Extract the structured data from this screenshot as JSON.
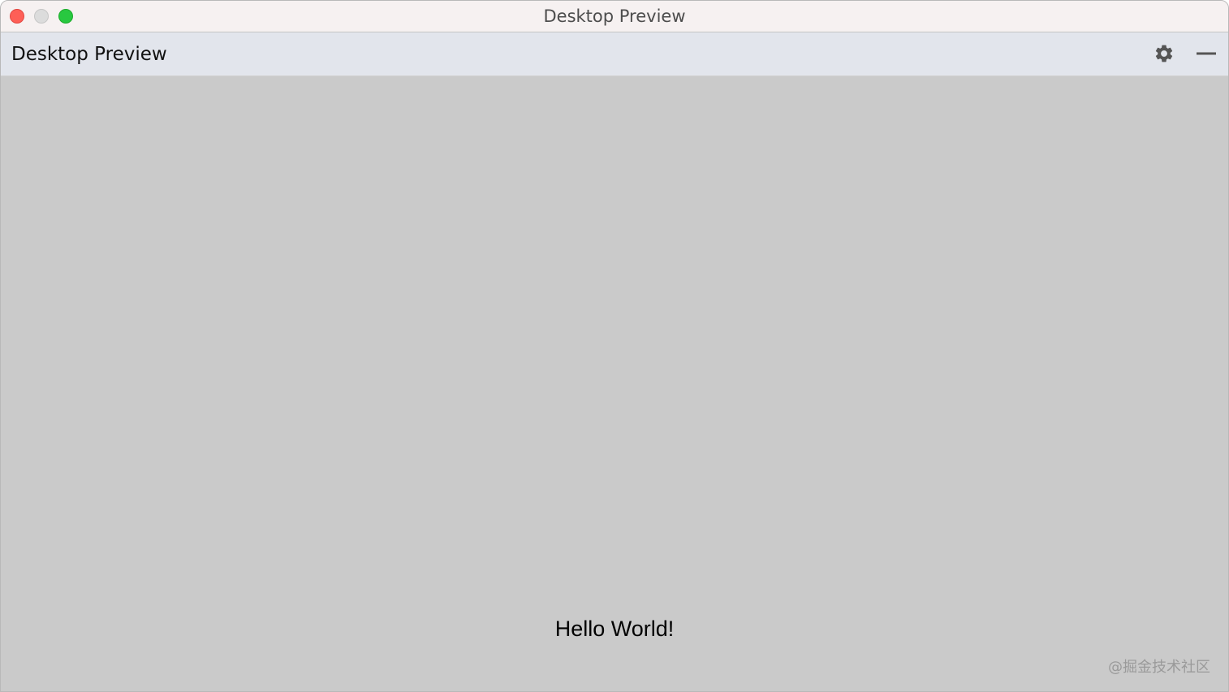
{
  "window": {
    "title": "Desktop Preview"
  },
  "toolbar": {
    "title": "Desktop Preview",
    "settings_icon": "gear-icon",
    "minimize_icon": "minus-icon"
  },
  "content": {
    "text": "Hello World!"
  },
  "watermark": {
    "text": "@掘金技术社区"
  },
  "colors": {
    "close": "#fe5f57",
    "minimize": "#dcdcdc",
    "zoom": "#28c840",
    "toolbar_bg": "#e2e5ec",
    "content_bg": "#cacaca"
  }
}
